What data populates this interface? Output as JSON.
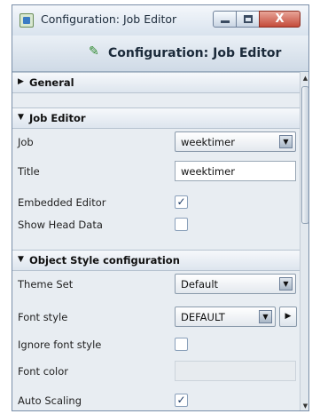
{
  "window": {
    "title": "Configuration: Job Editor",
    "icon": "app-icon",
    "controls": {
      "minimize": "minimize-icon",
      "maximize": "maximize-icon",
      "close_label": "X"
    }
  },
  "header": {
    "title": "Configuration: Job Editor",
    "icon": "edit-icon"
  },
  "sections": {
    "general": {
      "title": "General",
      "expanded": false
    },
    "job_editor": {
      "title": "Job Editor",
      "expanded": true,
      "job_label": "Job",
      "job_value": "weektimer",
      "title_label": "Title",
      "title_value": "weektimer",
      "embedded_label": "Embedded Editor",
      "embedded_checked": true,
      "head_label": "Show Head Data",
      "head_checked": false
    },
    "object_style": {
      "title": "Object Style configuration",
      "expanded": true,
      "theme_label": "Theme Set",
      "theme_value": "Default",
      "font_style_label": "Font style",
      "font_style_value": "DEFAULT",
      "ignore_label": "Ignore font style",
      "ignore_checked": false,
      "font_color_label": "Font color",
      "font_color_value": "",
      "auto_label": "Auto Scaling",
      "auto_checked": true
    }
  },
  "glyphs": {
    "collapsed": "▶",
    "expanded": "▼",
    "dropdown": "▼",
    "play": "▶",
    "check": "✓",
    "scroll_up": "▲",
    "scroll_down": "▼"
  }
}
